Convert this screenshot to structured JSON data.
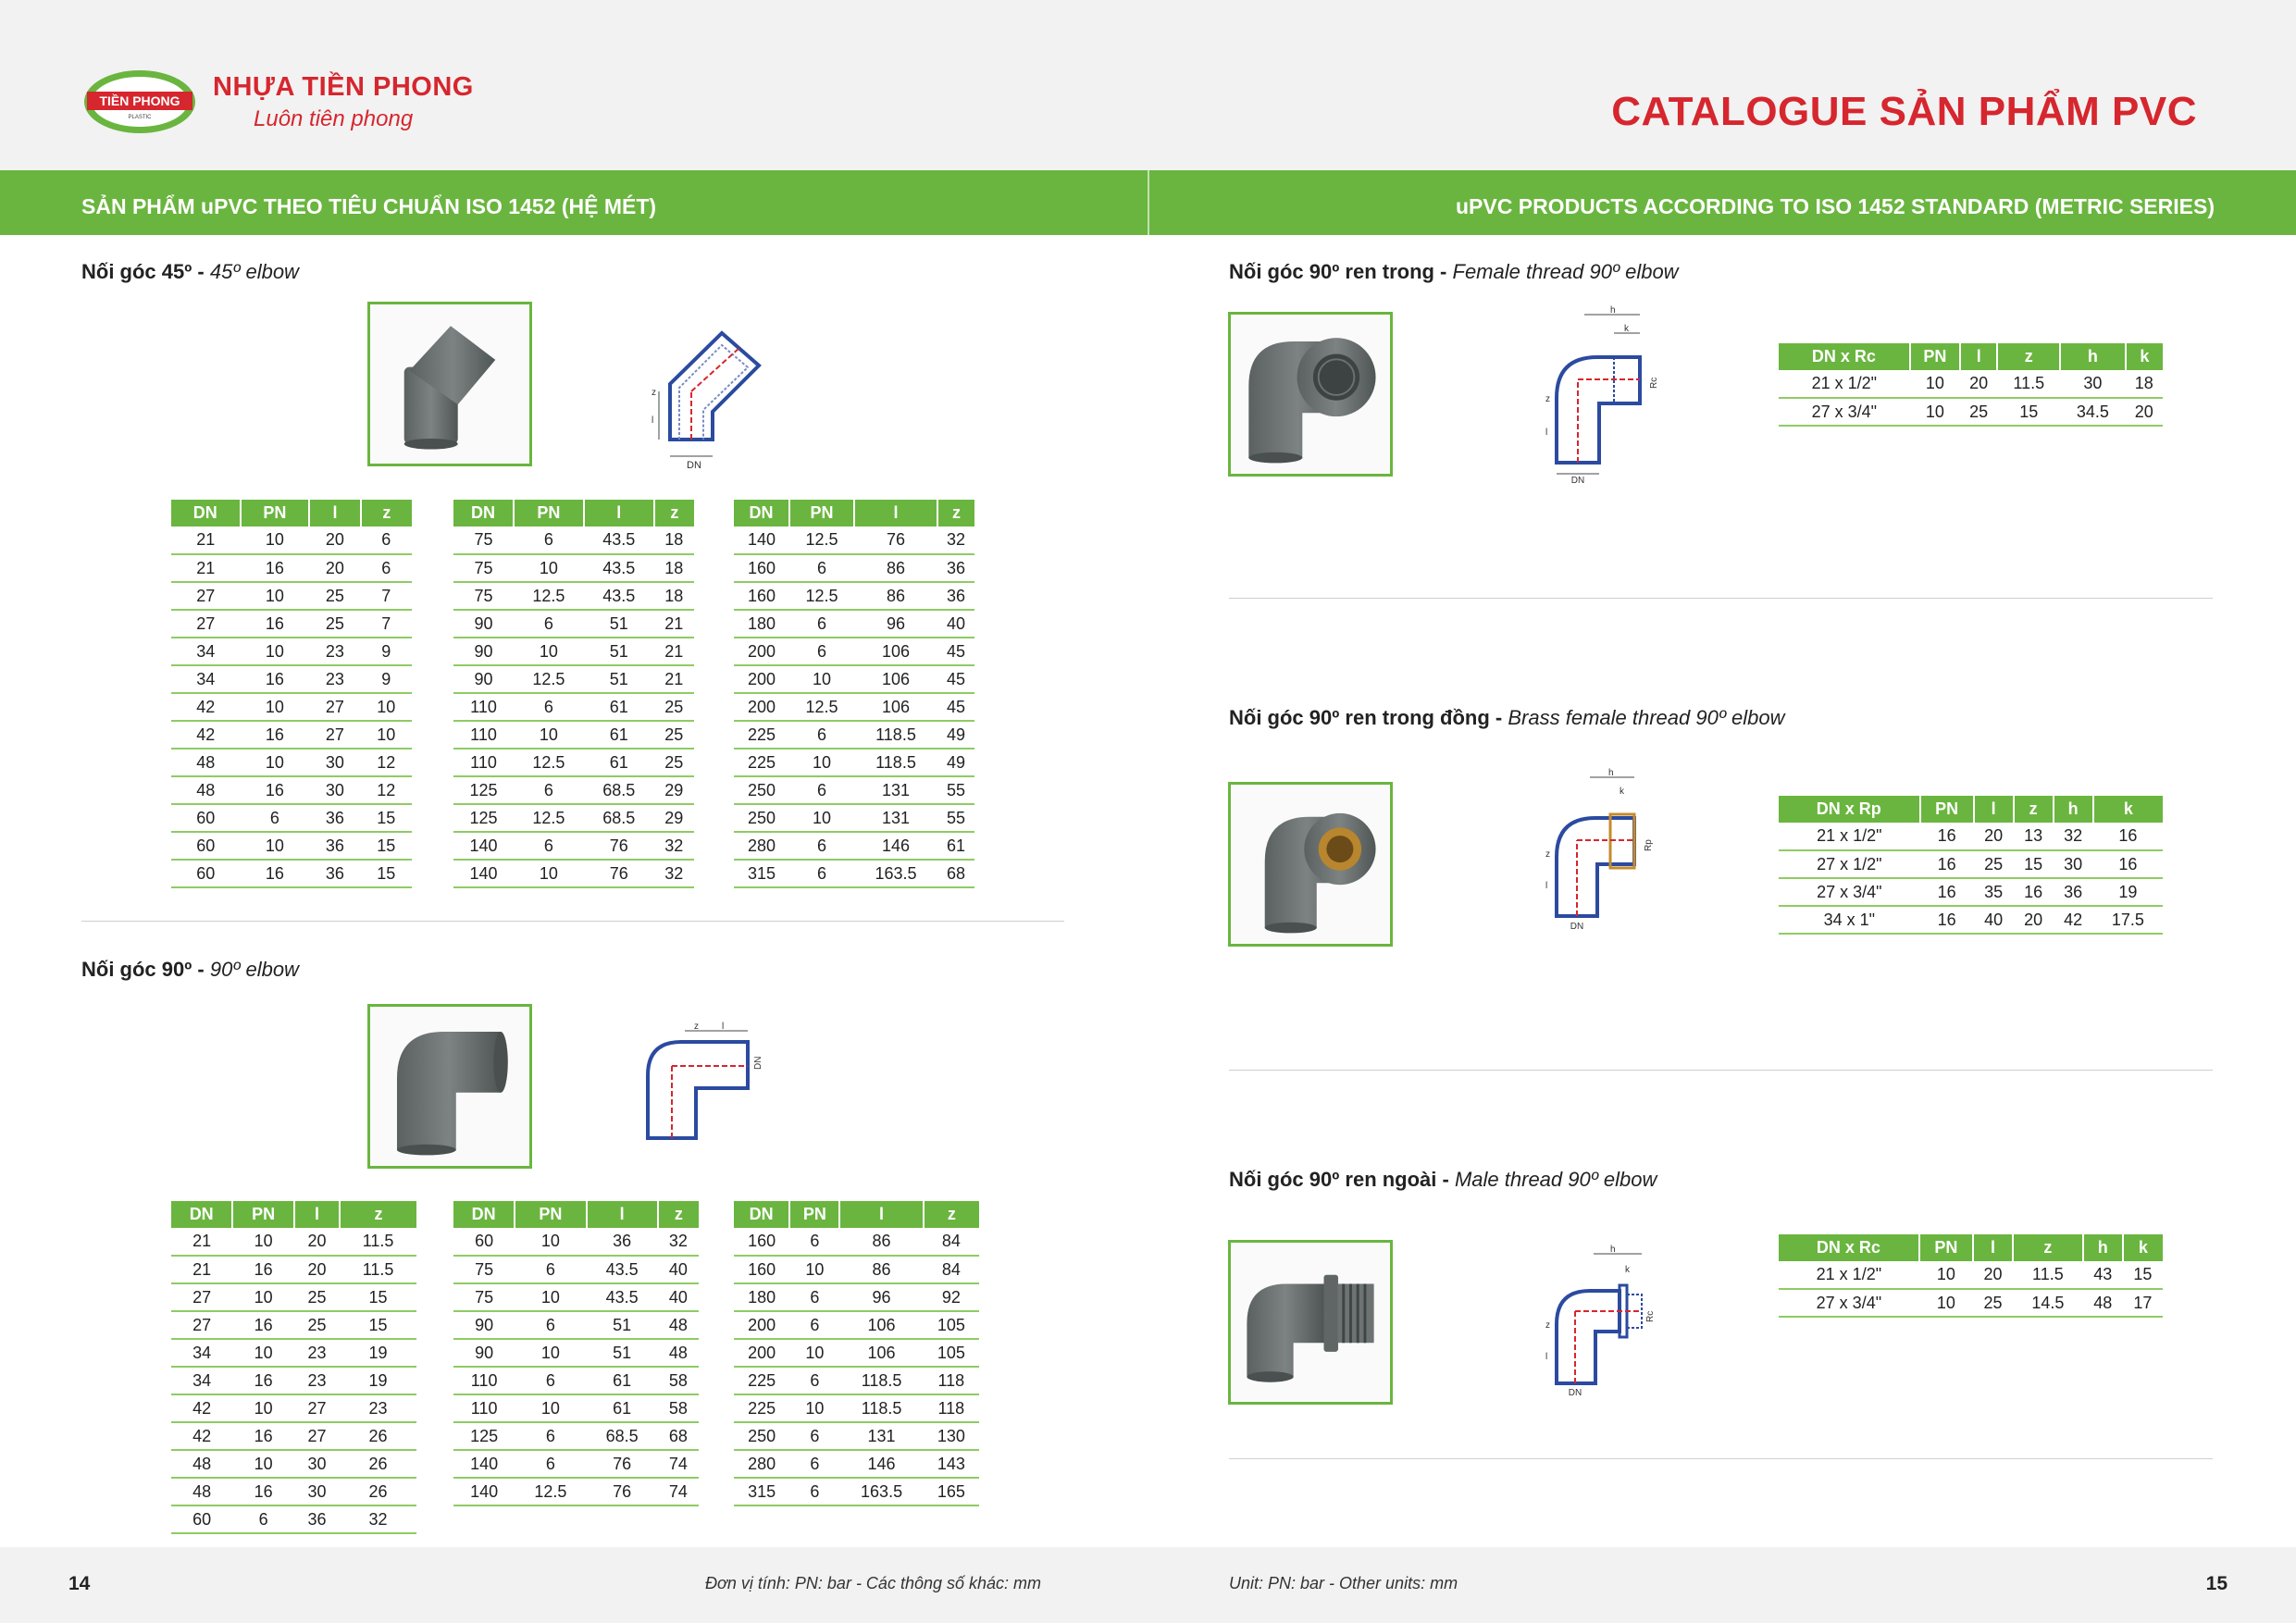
{
  "header": {
    "brand_name": "NHỰA TIỀN PHONG",
    "slogan": "Luôn tiên phong",
    "logo_text": "TIỀN PHONG",
    "logo_subtext": "PLASTIC",
    "catalogue_title": "CATALOGUE SẢN PHẨM PVC",
    "colors": {
      "brand_red": "#d6262e",
      "brand_green": "#6ab53f"
    }
  },
  "sections": {
    "left_heading": "SẢN PHẨM uPVC THEO TIÊU CHUẨN ISO 1452 (HỆ MÉT)",
    "right_heading": "uPVC PRODUCTS ACCORDING TO ISO 1452 STANDARD (METRIC SERIES)"
  },
  "products": {
    "elbow45": {
      "title_vi": "Nối góc 45º - ",
      "title_en": "45º elbow",
      "headers": [
        "DN",
        "PN",
        "l",
        "z"
      ],
      "tables": [
        [
          [
            "21",
            "10",
            "20",
            "6"
          ],
          [
            "21",
            "16",
            "20",
            "6"
          ],
          [
            "27",
            "10",
            "25",
            "7"
          ],
          [
            "27",
            "16",
            "25",
            "7"
          ],
          [
            "34",
            "10",
            "23",
            "9"
          ],
          [
            "34",
            "16",
            "23",
            "9"
          ],
          [
            "42",
            "10",
            "27",
            "10"
          ],
          [
            "42",
            "16",
            "27",
            "10"
          ],
          [
            "48",
            "10",
            "30",
            "12"
          ],
          [
            "48",
            "16",
            "30",
            "12"
          ],
          [
            "60",
            "6",
            "36",
            "15"
          ],
          [
            "60",
            "10",
            "36",
            "15"
          ],
          [
            "60",
            "16",
            "36",
            "15"
          ]
        ],
        [
          [
            "75",
            "6",
            "43.5",
            "18"
          ],
          [
            "75",
            "10",
            "43.5",
            "18"
          ],
          [
            "75",
            "12.5",
            "43.5",
            "18"
          ],
          [
            "90",
            "6",
            "51",
            "21"
          ],
          [
            "90",
            "10",
            "51",
            "21"
          ],
          [
            "90",
            "12.5",
            "51",
            "21"
          ],
          [
            "110",
            "6",
            "61",
            "25"
          ],
          [
            "110",
            "10",
            "61",
            "25"
          ],
          [
            "110",
            "12.5",
            "61",
            "25"
          ],
          [
            "125",
            "6",
            "68.5",
            "29"
          ],
          [
            "125",
            "12.5",
            "68.5",
            "29"
          ],
          [
            "140",
            "6",
            "76",
            "32"
          ],
          [
            "140",
            "10",
            "76",
            "32"
          ]
        ],
        [
          [
            "140",
            "12.5",
            "76",
            "32"
          ],
          [
            "160",
            "6",
            "86",
            "36"
          ],
          [
            "160",
            "12.5",
            "86",
            "36"
          ],
          [
            "180",
            "6",
            "96",
            "40"
          ],
          [
            "200",
            "6",
            "106",
            "45"
          ],
          [
            "200",
            "10",
            "106",
            "45"
          ],
          [
            "200",
            "12.5",
            "106",
            "45"
          ],
          [
            "225",
            "6",
            "118.5",
            "49"
          ],
          [
            "225",
            "10",
            "118.5",
            "49"
          ],
          [
            "250",
            "6",
            "131",
            "55"
          ],
          [
            "250",
            "10",
            "131",
            "55"
          ],
          [
            "280",
            "6",
            "146",
            "61"
          ],
          [
            "315",
            "6",
            "163.5",
            "68"
          ]
        ]
      ]
    },
    "elbow90": {
      "title_vi": "Nối góc 90º - ",
      "title_en": "90º elbow",
      "headers": [
        "DN",
        "PN",
        "l",
        "z"
      ],
      "tables": [
        [
          [
            "21",
            "10",
            "20",
            "11.5"
          ],
          [
            "21",
            "16",
            "20",
            "11.5"
          ],
          [
            "27",
            "10",
            "25",
            "15"
          ],
          [
            "27",
            "16",
            "25",
            "15"
          ],
          [
            "34",
            "10",
            "23",
            "19"
          ],
          [
            "34",
            "16",
            "23",
            "19"
          ],
          [
            "42",
            "10",
            "27",
            "23"
          ],
          [
            "42",
            "16",
            "27",
            "26"
          ],
          [
            "48",
            "10",
            "30",
            "26"
          ],
          [
            "48",
            "16",
            "30",
            "26"
          ],
          [
            "60",
            "6",
            "36",
            "32"
          ]
        ],
        [
          [
            "60",
            "10",
            "36",
            "32"
          ],
          [
            "75",
            "6",
            "43.5",
            "40"
          ],
          [
            "75",
            "10",
            "43.5",
            "40"
          ],
          [
            "90",
            "6",
            "51",
            "48"
          ],
          [
            "90",
            "10",
            "51",
            "48"
          ],
          [
            "110",
            "6",
            "61",
            "58"
          ],
          [
            "110",
            "10",
            "61",
            "58"
          ],
          [
            "125",
            "6",
            "68.5",
            "68"
          ],
          [
            "140",
            "6",
            "76",
            "74"
          ],
          [
            "140",
            "12.5",
            "76",
            "74"
          ]
        ],
        [
          [
            "160",
            "6",
            "86",
            "84"
          ],
          [
            "160",
            "10",
            "86",
            "84"
          ],
          [
            "180",
            "6",
            "96",
            "92"
          ],
          [
            "200",
            "6",
            "106",
            "105"
          ],
          [
            "200",
            "10",
            "106",
            "105"
          ],
          [
            "225",
            "6",
            "118.5",
            "118"
          ],
          [
            "225",
            "10",
            "118.5",
            "118"
          ],
          [
            "250",
            "6",
            "131",
            "130"
          ],
          [
            "280",
            "6",
            "146",
            "143"
          ],
          [
            "315",
            "6",
            "163.5",
            "165"
          ]
        ]
      ]
    },
    "female_thread": {
      "title_vi": "Nối góc 90º ren trong - ",
      "title_en": "Female thread 90º elbow",
      "headers": [
        "DN x Rc",
        "PN",
        "l",
        "z",
        "h",
        "k"
      ],
      "rows": [
        [
          "21 x 1/2\"",
          "10",
          "20",
          "11.5",
          "30",
          "18"
        ],
        [
          "27 x 3/4\"",
          "10",
          "25",
          "15",
          "34.5",
          "20"
        ]
      ]
    },
    "brass_female_thread": {
      "title_vi": "Nối góc 90º ren trong đồng - ",
      "title_en": "Brass female thread 90º elbow",
      "headers": [
        "DN x Rp",
        "PN",
        "l",
        "z",
        "h",
        "k"
      ],
      "rows": [
        [
          "21 x 1/2\"",
          "16",
          "20",
          "13",
          "32",
          "16"
        ],
        [
          "27 x 1/2\"",
          "16",
          "25",
          "15",
          "30",
          "16"
        ],
        [
          "27 x 3/4\"",
          "16",
          "35",
          "16",
          "36",
          "19"
        ],
        [
          "34 x 1\"",
          "16",
          "40",
          "20",
          "42",
          "17.5"
        ]
      ]
    },
    "male_thread": {
      "title_vi": "Nối góc 90º ren ngoài - ",
      "title_en": "Male thread 90º elbow",
      "headers": [
        "DN x Rc",
        "PN",
        "l",
        "z",
        "h",
        "k"
      ],
      "rows": [
        [
          "21 x 1/2\"",
          "10",
          "20",
          "11.5",
          "43",
          "15"
        ],
        [
          "27 x 3/4\"",
          "10",
          "25",
          "14.5",
          "48",
          "17"
        ]
      ]
    }
  },
  "drawing_labels": {
    "dn": "DN",
    "z": "z",
    "l": "l",
    "h": "h",
    "k": "k",
    "rc": "Rc",
    "rp": "Rp"
  },
  "footer": {
    "left_page": "14",
    "right_page": "15",
    "unit_vi": "Đơn vị tính: PN: bar - Các thông số khác: mm",
    "unit_en": "Unit: PN: bar - Other units: mm"
  }
}
